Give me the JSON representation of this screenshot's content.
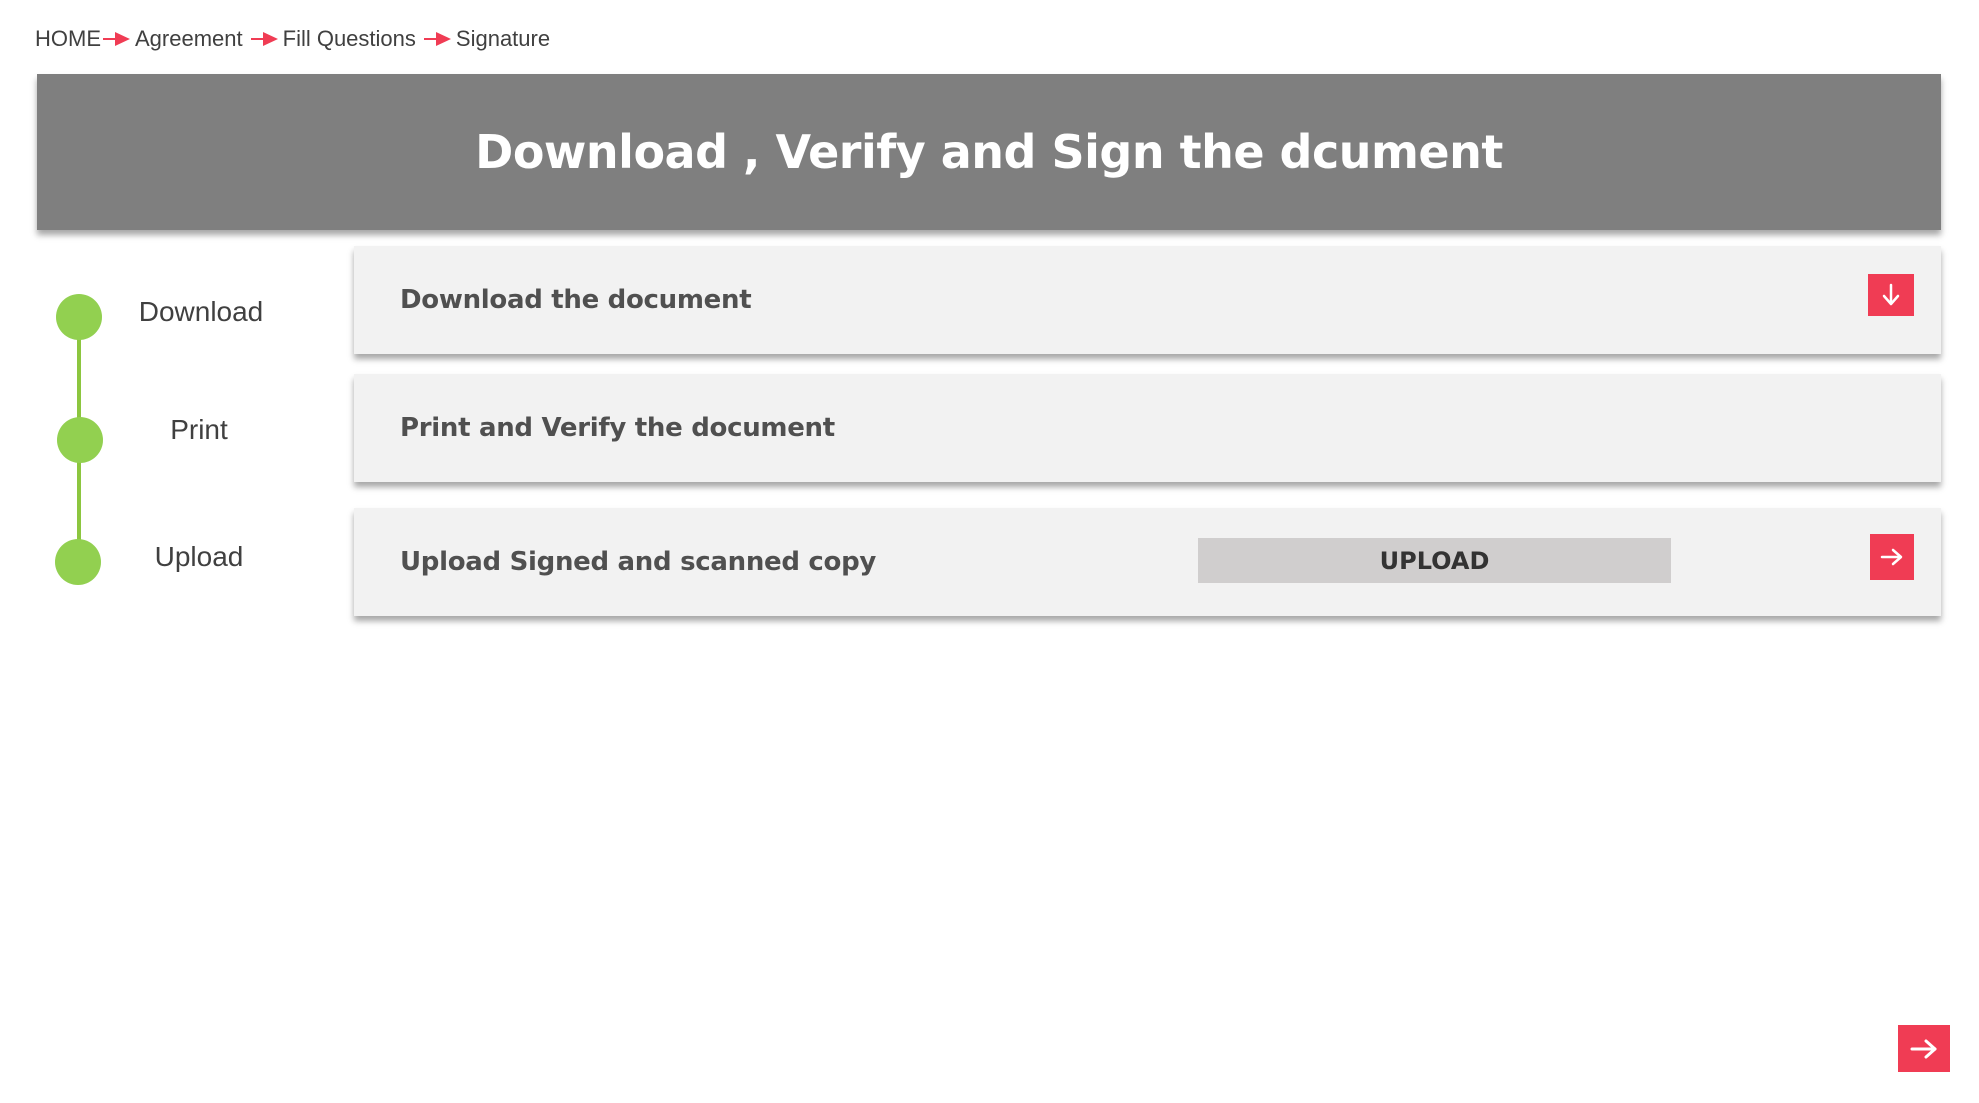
{
  "breadcrumb": {
    "items": [
      "HOME",
      "Agreement",
      "Fill Questions",
      "Signature"
    ],
    "arrow_color": "#f03c54"
  },
  "header": {
    "title": "Download , Verify and Sign the dcument",
    "background": "#7f7f7f"
  },
  "stepper": {
    "color": "#92d050",
    "steps": [
      {
        "label": "Download"
      },
      {
        "label": "Print"
      },
      {
        "label": "Upload"
      }
    ]
  },
  "tasks": {
    "download": {
      "title": "Download the document",
      "icon": "arrow-down-icon"
    },
    "print": {
      "title": "Print and Verify the document"
    },
    "upload": {
      "title": "Upload Signed and scanned copy",
      "button_label": "UPLOAD",
      "icon": "arrow-right-icon"
    }
  },
  "footer": {
    "next_icon": "arrow-right-icon",
    "accent": "#f03c54"
  }
}
